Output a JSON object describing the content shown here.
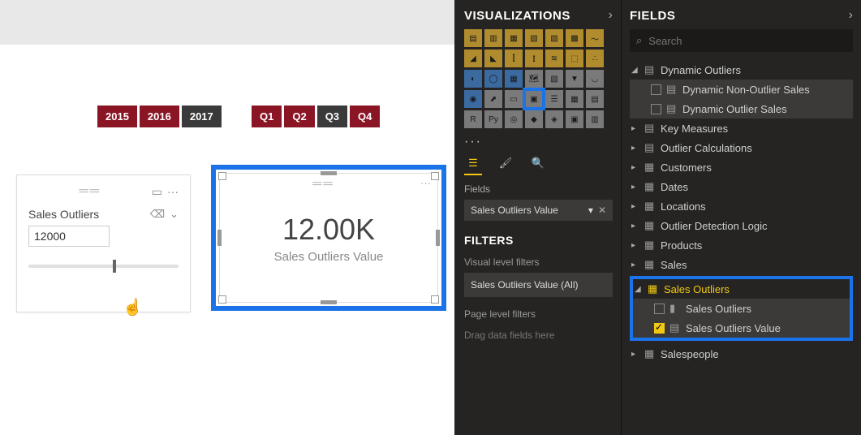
{
  "canvas": {
    "years": [
      "2015",
      "2016",
      "2017"
    ],
    "years_dark_index": 2,
    "quarters": [
      "Q1",
      "Q2",
      "Q3",
      "Q4"
    ],
    "quarters_dark_index": 2,
    "slicer": {
      "title": "Sales Outliers",
      "value": "12000"
    },
    "card": {
      "value": "12.00K",
      "label": "Sales Outliers Value"
    }
  },
  "viz": {
    "title": "VISUALIZATIONS",
    "fields_label": "Fields",
    "field_well": "Sales Outliers Value",
    "filters_title": "FILTERS",
    "visual_filters_label": "Visual level filters",
    "visual_filter_item": "Sales Outliers Value (All)",
    "page_filters_label": "Page level filters",
    "page_filters_hint": "Drag data fields here"
  },
  "fields": {
    "title": "FIELDS",
    "search_placeholder": "Search",
    "tables": {
      "dynamic_outliers": {
        "label": "Dynamic Outliers",
        "children": [
          "Dynamic Non-Outlier Sales",
          "Dynamic Outlier Sales"
        ]
      },
      "key_measures": "Key Measures",
      "outlier_calc": "Outlier Calculations",
      "customers": "Customers",
      "dates": "Dates",
      "locations": "Locations",
      "outlier_logic": "Outlier Detection Logic",
      "products": "Products",
      "sales": "Sales",
      "sales_outliers": {
        "label": "Sales Outliers",
        "children": [
          {
            "label": "Sales Outliers",
            "checked": false
          },
          {
            "label": "Sales Outliers Value",
            "checked": true
          }
        ]
      },
      "salespeople": "Salespeople"
    }
  }
}
